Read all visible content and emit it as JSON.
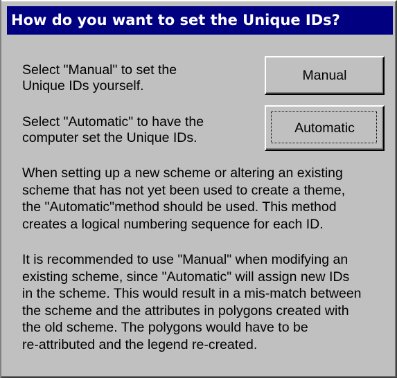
{
  "dialog": {
    "title": "How do you want to set the Unique IDs?",
    "manual_prompt": "Select \"Manual\" to set the\nUnique IDs yourself.",
    "automatic_prompt": "Select \"Automatic\" to have the\ncomputer set the Unique IDs.",
    "manual_button": "Manual",
    "automatic_button": "Automatic",
    "paragraph_1": "When setting up a new scheme or altering an existing\nscheme that has not yet been used to create a theme,\nthe \"Automatic\"method should be used. This method\ncreates a logical numbering sequence for each ID.",
    "paragraph_2": "It is recommended to use \"Manual\" when modifying an\nexisting scheme, since \"Automatic\" will assign new IDs\nin the scheme. This would result in a mis-match between\nthe scheme and the attributes in polygons created with\nthe old scheme. The polygons would have to be\nre-attributed and the legend re-created."
  },
  "colors": {
    "titlebar_bg": "#000080",
    "titlebar_text": "#ffffff",
    "dialog_bg": "#c0c0c0"
  }
}
